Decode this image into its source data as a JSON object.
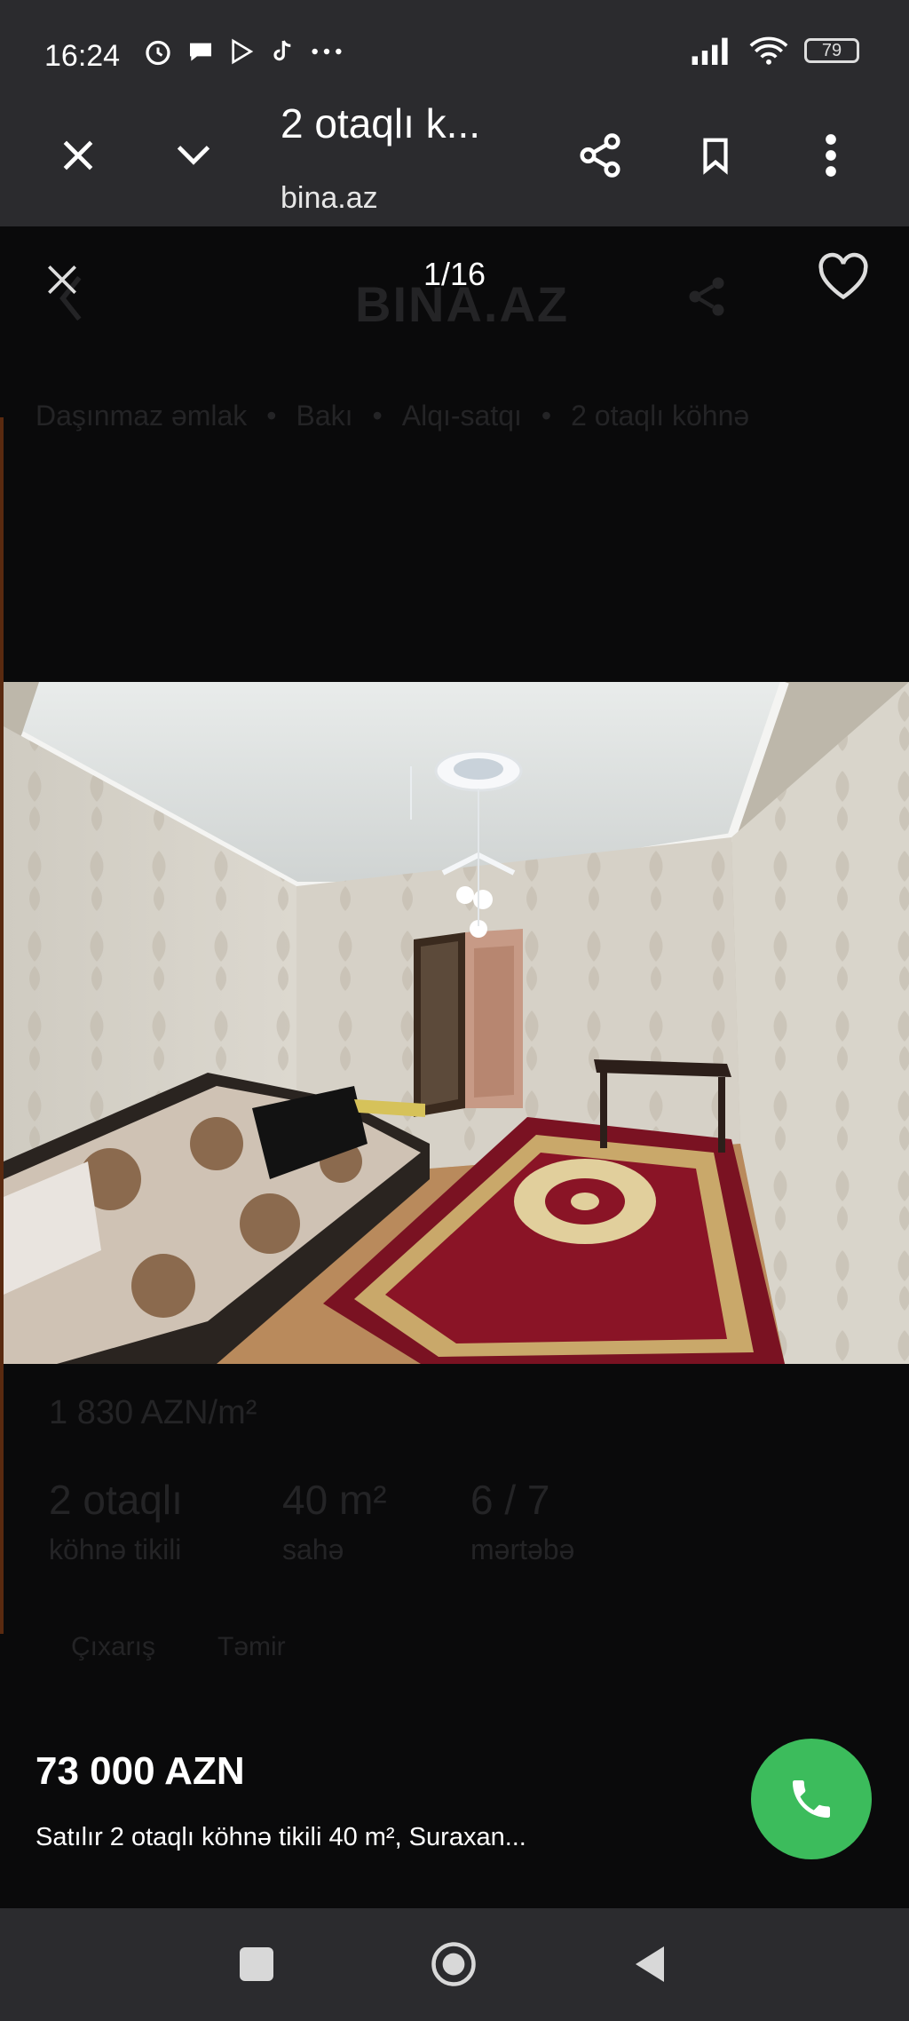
{
  "status_bar": {
    "time": "16:24",
    "battery": "79",
    "left_icons": [
      "alarm-icon",
      "chat-icon",
      "play-store-icon",
      "tiktok-icon",
      "more-dots-icon"
    ],
    "right_icons": [
      "signal-icon",
      "wifi-icon",
      "battery-icon"
    ]
  },
  "browser": {
    "title": "2 otaqlı k...",
    "url": "bina.az"
  },
  "lightbox": {
    "counter": "1/16"
  },
  "background_page": {
    "logo": "BINA.AZ",
    "breadcrumb": [
      "Daşınmaz əmlak",
      "•",
      "Bakı",
      "•",
      "Alqı-satqı",
      "•",
      "2 otaqlı köhnə"
    ],
    "price_per_m2": "1 830 AZN/m²",
    "stats": [
      {
        "value": "2 otaqlı",
        "label": "köhnə tikili"
      },
      {
        "value": "40 m²",
        "label": "sahə"
      },
      {
        "value": "6 / 7",
        "label": "mərtəbə"
      }
    ],
    "tags": [
      "Çıxarış",
      "Təmir"
    ]
  },
  "listing": {
    "price": "73 000 AZN",
    "description": "Satılır 2 otaqlı köhnə tikili 40 m², Suraxan..."
  },
  "colors": {
    "call_button": "#3cbc5c",
    "bars": "#2b2b2e"
  }
}
